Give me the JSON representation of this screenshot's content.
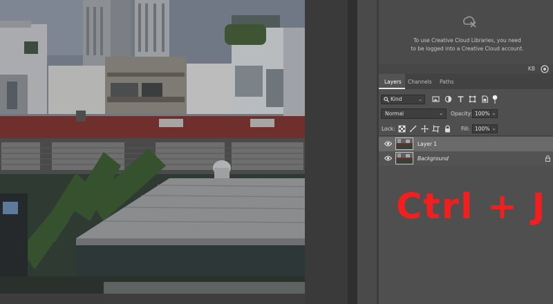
{
  "creative_cloud": {
    "message": "To use Creative Cloud Libraries, you need to be logged into a Creative Cloud account.",
    "account_initials": "KB"
  },
  "panel_tabs": [
    "Layers",
    "Channels",
    "Paths"
  ],
  "filter": {
    "kind_label": "Kind",
    "icons": [
      "pixel-filter-icon",
      "adjustment-filter-icon",
      "type-filter-icon",
      "shape-filter-icon",
      "smart-object-filter-icon"
    ]
  },
  "blending": {
    "mode": "Normal",
    "opacity_label": "Opacity:",
    "opacity_value": "100%"
  },
  "locks": {
    "label": "Lock:",
    "icons": [
      "lock-transparent-icon",
      "lock-image-icon",
      "lock-position-icon",
      "lock-artboard-icon",
      "lock-all-icon"
    ],
    "fill_label": "Fill:",
    "fill_value": "100%"
  },
  "layers": [
    {
      "name": "Layer 1",
      "selected": true,
      "locked": false
    },
    {
      "name": "Background",
      "selected": false,
      "locked": true
    }
  ],
  "overlay_text": "Ctrl + J",
  "colors": {
    "overlay_text": "#f21f1f",
    "selected_layer": "#6a6a6a",
    "panel_bg": "#535353"
  }
}
